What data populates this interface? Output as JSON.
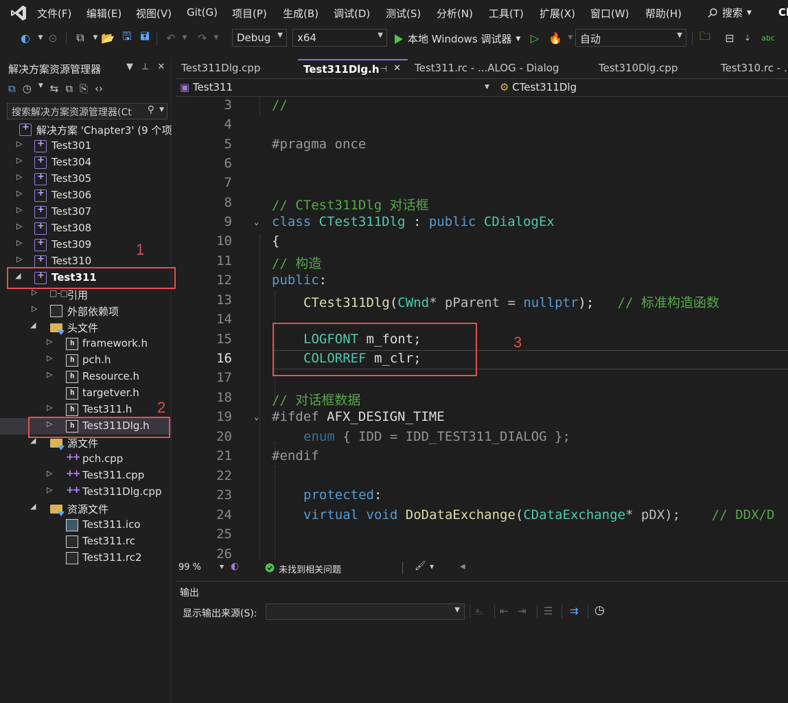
{
  "menu": {
    "items": [
      "文件(F)",
      "编辑(E)",
      "视图(V)",
      "Git(G)",
      "项目(P)",
      "生成(B)",
      "调试(D)",
      "测试(S)",
      "分析(N)",
      "工具(T)",
      "扩展(X)",
      "窗口(W)",
      "帮助(H)"
    ],
    "search": "搜索",
    "badge": "Ch"
  },
  "toolbar": {
    "config": "Debug",
    "platform": "x64",
    "run_label": "本地 Windows 调试器",
    "auto": "自动"
  },
  "solution_explorer": {
    "title": "解决方案资源管理器",
    "search_placeholder": "搜索解决方案资源管理器(Ct",
    "solution": "解决方案 'Chapter3' (9 个项",
    "projects": [
      "Test301",
      "Test304",
      "Test305",
      "Test306",
      "Test307",
      "Test308",
      "Test309",
      "Test310"
    ],
    "active_project": "Test311",
    "refs": "引用",
    "external": "外部依赖项",
    "headers_folder": "头文件",
    "headers": [
      "framework.h",
      "pch.h",
      "Resource.h",
      "targetver.h",
      "Test311.h",
      "Test311Dlg.h"
    ],
    "sources_folder": "源文件",
    "sources": [
      "pch.cpp",
      "Test311.cpp",
      "Test311Dlg.cpp"
    ],
    "resources_folder": "资源文件",
    "resources": [
      "Test311.ico",
      "Test311.rc",
      "Test311.rc2"
    ]
  },
  "annotations": [
    "1",
    "2",
    "3"
  ],
  "tabs": [
    "Test311Dlg.cpp",
    "Test311Dlg.h",
    "Test311.rc - ...ALOG - Dialog",
    "Test310Dlg.cpp",
    "Test310.rc - ..."
  ],
  "nav": {
    "scope": "Test311",
    "member": "CTest311Dlg"
  },
  "code": {
    "line_numbers": [
      "3",
      "4",
      "5",
      "6",
      "7",
      "8",
      "9",
      "10",
      "11",
      "12",
      "13",
      "14",
      "15",
      "16",
      "17",
      "18",
      "19",
      "20",
      "21",
      "22",
      "23",
      "24",
      "25",
      "26"
    ],
    "l3": "//",
    "l5": "#pragma once",
    "l8": "// CTest311Dlg 对话框",
    "l9_kw": "class",
    "l9_name": "CTest311Dlg",
    "l9_colon": " : ",
    "l9_pub": "public",
    "l9_base": "CDialogEx",
    "l10": "{",
    "l11": "// 构造",
    "l12_kw": "public",
    "l12_colon": ":",
    "l13_fn": "CTest311Dlg",
    "l13_open": "(",
    "l13_type": "CWnd",
    "l13_mid": "* pParent = ",
    "l13_null": "nullptr",
    "l13_close": ");",
    "l13_cm": "// 标准构造函数",
    "l15_type": "LOGFONT",
    "l15_rest": " m_font;",
    "l16_type": "COLORREF",
    "l16_rest": " m_clr;",
    "l18": "// 对话框数据",
    "l19_pp": "#ifdef",
    "l19_mac": "AFX_DESIGN_TIME",
    "l20_kw": "enum",
    "l20_rest": " { IDD = IDD_TEST311_DIALOG };",
    "l21": "#endif",
    "l23_kw": "protected",
    "l23_colon": ":",
    "l24_kw1": "virtual",
    "l24_kw2": "void",
    "l24_fn": "DoDataExchange",
    "l24_open": "(",
    "l24_type": "CDataExchange",
    "l24_rest": "* pDX);",
    "l24_cm": "// DDX/D"
  },
  "status": {
    "zoom": "99 %",
    "issues": "未找到相关问题"
  },
  "output": {
    "title": "输出",
    "source_label": "显示输出来源(S):"
  },
  "colors": {
    "accent": "#8f6be8",
    "annotation_red": "#e05252"
  }
}
